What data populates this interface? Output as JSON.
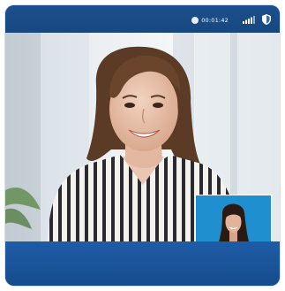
{
  "status_bar": {
    "call_duration": "00:01:42",
    "icons": [
      "record-dot-icon",
      "signal-strength-icon",
      "shield-icon"
    ]
  },
  "video_call": {
    "main_feed": "remote-participant-video",
    "self_view": "self-preview-video"
  },
  "colors": {
    "frame": "#1a4f91",
    "bottom_bar": "#1f5ca7",
    "self_view_bg": "#1f8fd0"
  }
}
